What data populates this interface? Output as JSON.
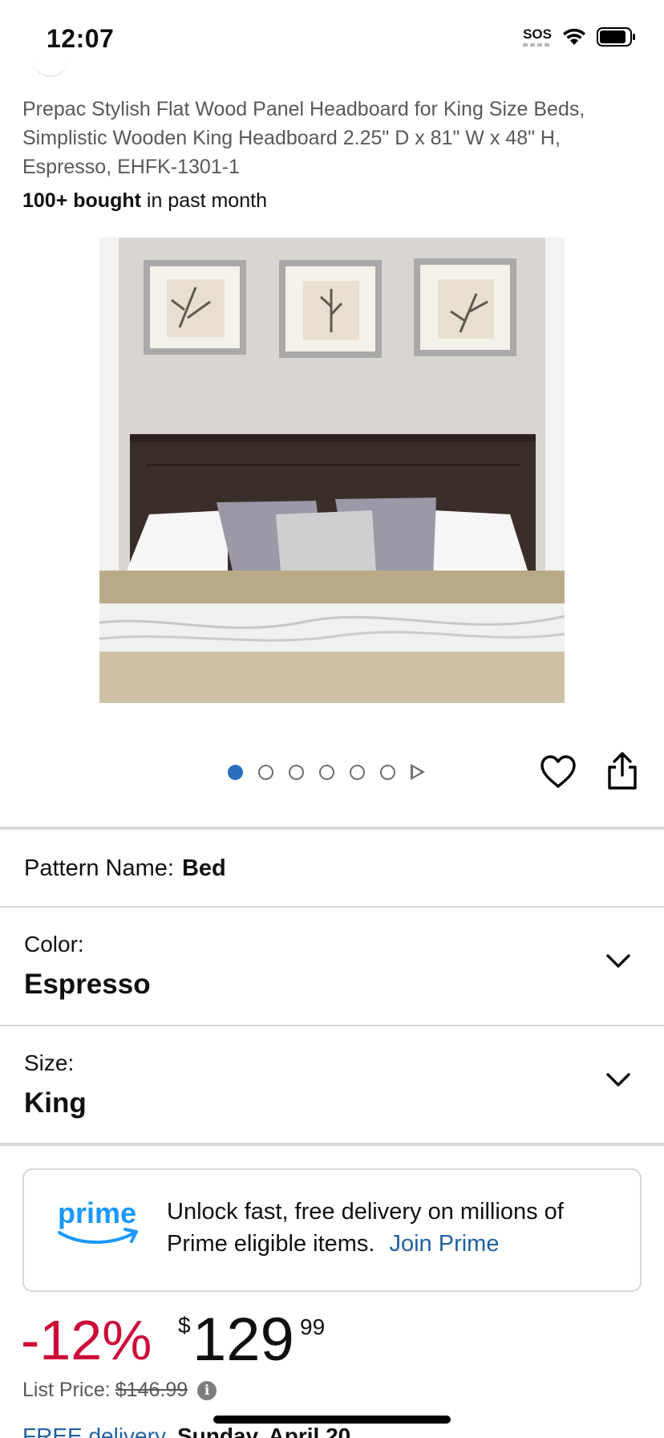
{
  "status_bar": {
    "time": "12:07",
    "sos": "SOS"
  },
  "product": {
    "title": "Prepac Stylish Flat Wood Panel Headboard for King Size Beds, Simplistic Wooden King Headboard 2.25\" D x 81\" W x 48\" H, Espresso, EHFK-1301-1",
    "bought_count": "100+ bought",
    "bought_suffix": " in past month"
  },
  "gallery": {
    "image_count": 6,
    "active_index": 0
  },
  "pattern": {
    "label": "Pattern Name:",
    "value": "Bed"
  },
  "color": {
    "label": "Color:",
    "value": "Espresso"
  },
  "size": {
    "label": "Size:",
    "value": "King"
  },
  "prime": {
    "logo_text": "prime",
    "message": "Unlock fast, free delivery on millions of Prime eligible items.",
    "link": "Join Prime"
  },
  "price": {
    "discount": "-12%",
    "currency": "$",
    "whole": "129",
    "fraction": "99",
    "list_price_label": "List Price:",
    "list_price": "$146.99"
  },
  "delivery_peek": {
    "free_label": "FREE delivery",
    "date": "Sunday, April 20"
  },
  "colors": {
    "discount_red": "#cc0c39",
    "link_blue": "#2162a1",
    "prime_blue": "#1a98ff",
    "active_dot": "#2a6ebd"
  }
}
